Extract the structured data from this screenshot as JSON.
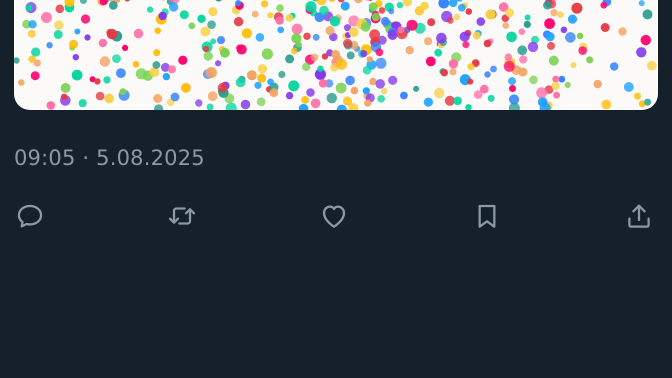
{
  "post": {
    "timestamp": "09:05 · 5.08.2025",
    "media_description_icon": "confetti-photo"
  },
  "actions": [
    {
      "name": "reply",
      "icon": "speech-bubble-icon"
    },
    {
      "name": "retweet",
      "icon": "retweet-icon"
    },
    {
      "name": "like",
      "icon": "heart-icon"
    },
    {
      "name": "bookmark",
      "icon": "bookmark-icon"
    },
    {
      "name": "share",
      "icon": "share-icon"
    }
  ],
  "colors": {
    "background": "#15202b",
    "muted_text": "#8b98a5",
    "icon": "#8b98a5"
  }
}
